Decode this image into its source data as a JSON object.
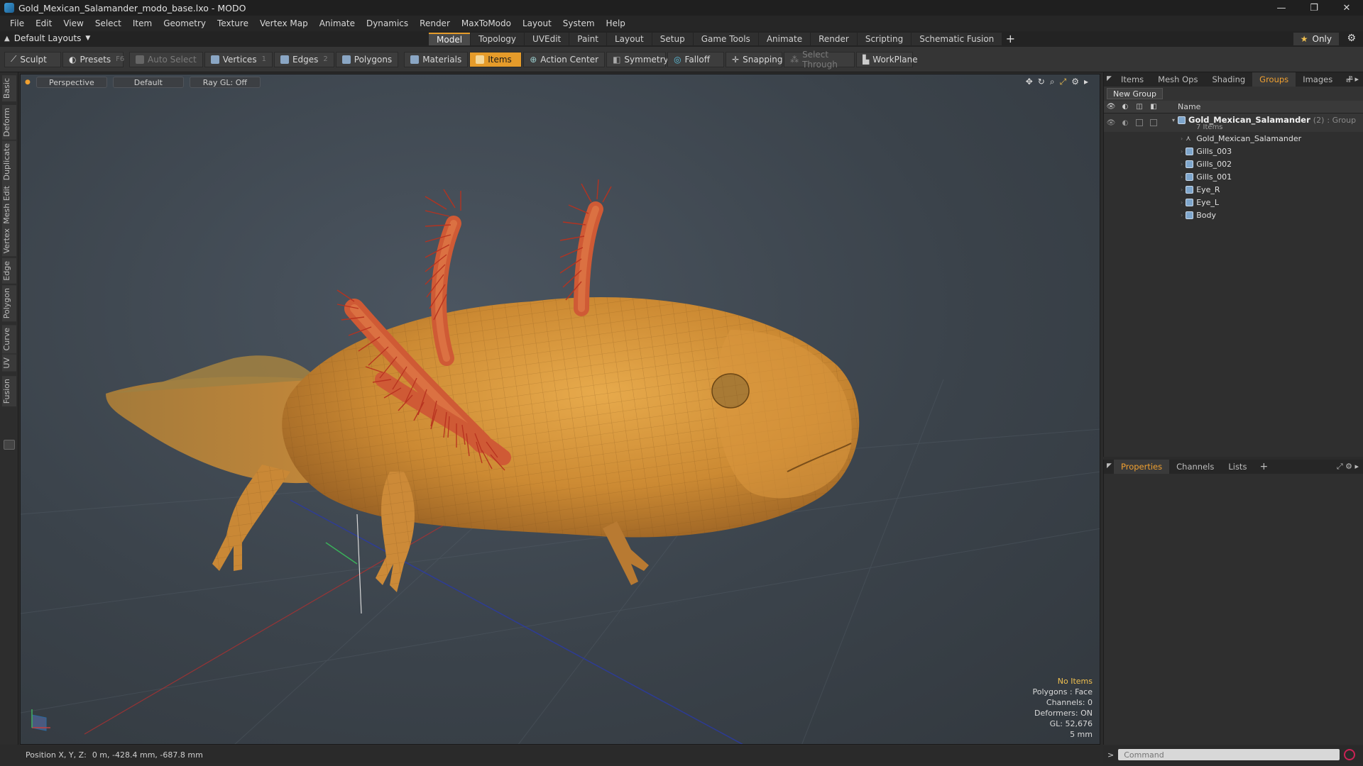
{
  "window": {
    "title": "Gold_Mexican_Salamander_modo_base.lxo - MODO",
    "controls": [
      "—",
      "❐",
      "✕"
    ]
  },
  "menu": [
    "File",
    "Edit",
    "View",
    "Select",
    "Item",
    "Geometry",
    "Texture",
    "Vertex Map",
    "Animate",
    "Dynamics",
    "Render",
    "MaxToModo",
    "Layout",
    "System",
    "Help"
  ],
  "layout_selector": "Default Layouts",
  "layout_tabs": [
    "Model",
    "Topology",
    "UVEdit",
    "Paint",
    "Layout",
    "Setup",
    "Game Tools",
    "Animate",
    "Render",
    "Scripting",
    "Schematic Fusion"
  ],
  "active_layout_tab": "Model",
  "only_label": "Only",
  "toolbar": {
    "sculpt": "Sculpt",
    "presets": "Presets",
    "presets_key": "F6",
    "auto_select": "Auto Select",
    "vertices": "Vertices",
    "vertices_count": "1",
    "edges": "Edges",
    "edges_count": "2",
    "polygons": "Polygons",
    "materials": "Materials",
    "items": "Items",
    "action_center": "Action Center",
    "symmetry": "Symmetry",
    "falloff": "Falloff",
    "snapping": "Snapping",
    "select_through": "Select Through",
    "workplane": "WorkPlane"
  },
  "left_tabs": [
    "Basic",
    "Deform",
    "Duplicate",
    "Mesh Edit",
    "Vertex",
    "Edge",
    "Polygon",
    "Curve",
    "UV",
    "Fusion"
  ],
  "viewport": {
    "view": "Perspective",
    "shading": "Default",
    "raygl": "Ray GL: Off",
    "info": {
      "no_items": "No Items",
      "polygons": "Polygons : Face",
      "channels": "Channels: 0",
      "deformers": "Deformers: ON",
      "gl": "GL: 52,676",
      "scale": "5 mm"
    },
    "colors": {
      "body": "#d4943a",
      "gills": "#c2402a",
      "background": "#3b434b"
    }
  },
  "status": {
    "position_label": "Position X, Y, Z:",
    "position_value": "0 m, -428.4 mm, -687.8 mm"
  },
  "right_top_tabs": [
    "Items",
    "Mesh Ops",
    "Shading",
    "Groups",
    "Images"
  ],
  "active_right_top_tab": "Groups",
  "groups": {
    "new_group": "New Group",
    "name_header": "Name",
    "group_name": "Gold_Mexican_Salamander",
    "group_count": "(2)",
    "group_type": ": Group",
    "group_items": "7 Items",
    "children": [
      "Gold_Mexican_Salamander",
      "Gills_003",
      "Gills_002",
      "Gills_001",
      "Eye_R",
      "Eye_L",
      "Body"
    ]
  },
  "right_bottom_tabs": [
    "Properties",
    "Channels",
    "Lists"
  ],
  "active_right_bottom_tab": "Properties",
  "command": {
    "prompt": ">",
    "placeholder": "Command"
  }
}
